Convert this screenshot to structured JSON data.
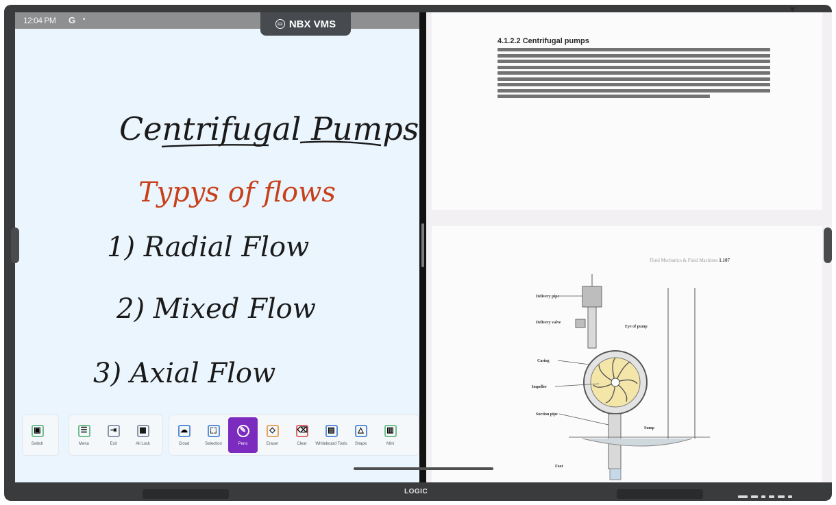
{
  "status_bar": {
    "time": "12:04 PM",
    "google_glyph": "G",
    "dot": "•"
  },
  "app_pill": {
    "label": "NBX VMS",
    "icon": "screen-share-icon"
  },
  "whiteboard": {
    "title": "Centrifugal Pumps",
    "subtitle": "Typys of flows",
    "items": [
      "1) Radial Flow",
      "2) Mixed Flow",
      "3) Axial Flow"
    ],
    "ink_color": "#1a1a1a",
    "accent_color": "#c8401a"
  },
  "toolbar": {
    "groups": [
      {
        "tools": [
          {
            "label": "Switch",
            "glyph": "▣"
          }
        ]
      },
      {
        "tools": [
          {
            "label": "Menu",
            "glyph": "☰"
          },
          {
            "label": "Exit",
            "glyph": "⇥"
          },
          {
            "label": "All Lock",
            "glyph": "▦"
          }
        ]
      },
      {
        "tools": [
          {
            "label": "Cloud",
            "glyph": "☁"
          },
          {
            "label": "Selection",
            "glyph": "⬚"
          },
          {
            "label": "Pens",
            "glyph": "✎",
            "active": true
          },
          {
            "label": "Eraser",
            "glyph": "◇"
          },
          {
            "label": "Clear",
            "glyph": "⌫"
          },
          {
            "label": "Whiteboard Tools",
            "glyph": "▤"
          },
          {
            "label": "Shape",
            "glyph": "△"
          },
          {
            "label": "Mini",
            "glyph": "▥"
          }
        ]
      }
    ],
    "active_color": "#7b2cbf"
  },
  "document": {
    "section_heading": "4.1.2.2 Centrifugal pumps",
    "page_header": "Fluid Mechanics & Fluid Machines",
    "page_number": "1.107",
    "diagram_labels": [
      "Delivery pipe",
      "Delivery valve",
      "Eye of pump",
      "Casing",
      "Impeller",
      "Suction pipe",
      "Sump",
      "Foot"
    ]
  },
  "monitor": {
    "brand": "LOGIC"
  }
}
